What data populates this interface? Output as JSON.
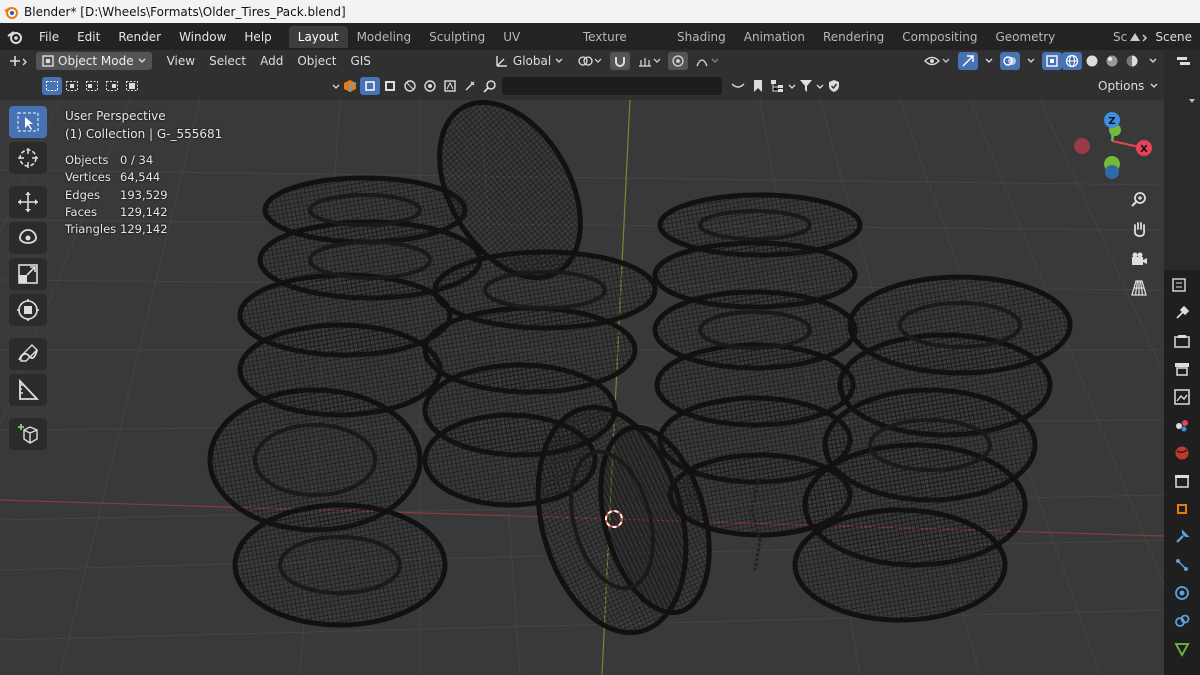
{
  "window": {
    "title": "Blender* [D:\\Wheels\\Formats\\Older_Tires_Pack.blend]"
  },
  "menu": [
    "File",
    "Edit",
    "Render",
    "Window",
    "Help"
  ],
  "workspaces": [
    "Layout",
    "Modeling",
    "Sculpting",
    "UV Editing",
    "Texture Paint",
    "Shading",
    "Animation",
    "Rendering",
    "Compositing",
    "Geometry Nodes",
    "Scripting"
  ],
  "active_workspace": "Layout",
  "scene_label": "Scene",
  "header": {
    "mode": "Object Mode",
    "menus": [
      "View",
      "Select",
      "Add",
      "Object",
      "GIS"
    ],
    "transform_orientation": "Global"
  },
  "options_label": "Options",
  "viewport": {
    "perspective": "User Perspective",
    "collection": "(1) Collection | G-_555681"
  },
  "stats": [
    {
      "label": "Objects",
      "value": "0 / 34"
    },
    {
      "label": "Vertices",
      "value": "64,544"
    },
    {
      "label": "Edges",
      "value": "193,529"
    },
    {
      "label": "Faces",
      "value": "129,142"
    },
    {
      "label": "Triangles",
      "value": "129,142"
    }
  ],
  "gizmo": {
    "x_label": "X",
    "z_label": "Z"
  },
  "colors": {
    "accent": "#4772b3",
    "x_axis": "#e8425a",
    "y_axis": "#74b93a",
    "z_axis": "#3b8fe0"
  }
}
